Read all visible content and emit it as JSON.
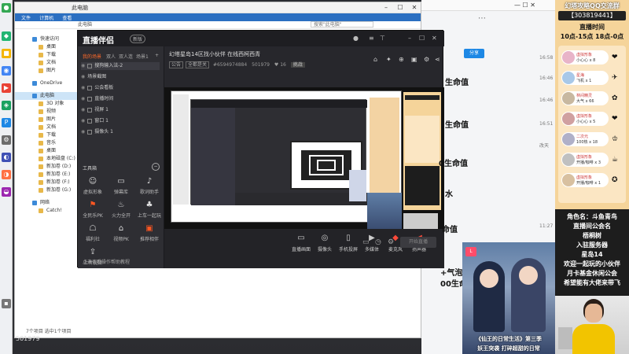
{
  "explorer": {
    "title": "此电脑",
    "ribbon": [
      "文件",
      "计算机",
      "查看"
    ],
    "address": "此电脑",
    "search_placeholder": "搜索\"此电脑\"",
    "sidebar": [
      {
        "label": "快速访问",
        "top": true
      },
      {
        "label": "桌面"
      },
      {
        "label": "下载"
      },
      {
        "label": "文档"
      },
      {
        "label": "图片"
      },
      {
        "label": "OneDrive",
        "top": true
      },
      {
        "label": "此电脑",
        "top": true,
        "selected": true
      },
      {
        "label": "3D 对象"
      },
      {
        "label": "视频"
      },
      {
        "label": "图片"
      },
      {
        "label": "文档"
      },
      {
        "label": "下载"
      },
      {
        "label": "音乐"
      },
      {
        "label": "桌面"
      },
      {
        "label": "本地磁盘 (C:)"
      },
      {
        "label": "新加卷 (D:)"
      },
      {
        "label": "新加卷 (E:)"
      },
      {
        "label": "新加卷 (F:)"
      },
      {
        "label": "新加卷 (G:)"
      },
      {
        "label": "网络",
        "top": true
      },
      {
        "label": "Catch!"
      }
    ],
    "status": "7个项目  选中1个项目"
  },
  "bg": {
    "share_label": "分享",
    "times": [
      "16:58",
      "16:46",
      "16:46",
      "16:51",
      "11:27"
    ],
    "date_label": "改天"
  },
  "app": {
    "logo": "直播伴侣",
    "version": "新版",
    "scene_tabs": [
      "我的场景",
      "双人",
      "双人连",
      "场景1",
      "+"
    ],
    "sources": [
      {
        "label": "搜狗输入法-2",
        "chk": true
      },
      {
        "label": "场景截图"
      },
      {
        "label": "公会看板",
        "chk": true
      },
      {
        "label": "直播时间",
        "chk": true
      },
      {
        "label": "视屏 1",
        "chk": true
      },
      {
        "label": "窗口 1",
        "chk": true
      },
      {
        "label": "摄像头 1",
        "chk": true
      }
    ],
    "tools_title": "工具箱",
    "tools": [
      {
        "label": "虚拟形象",
        "icon": "☺"
      },
      {
        "label": "弹幕库",
        "icon": "▭"
      },
      {
        "label": "歌词助手",
        "icon": "♪"
      },
      {
        "label": "全民乐PK",
        "icon": "⚑",
        "hot": true
      },
      {
        "label": "火力全开",
        "icon": "♨"
      },
      {
        "label": "上车一起玩",
        "icon": "♣"
      },
      {
        "label": "福利社",
        "icon": "☖"
      },
      {
        "label": "视频PK",
        "icon": "⌂"
      },
      {
        "label": "推荐相伴",
        "icon": "▣",
        "hot": true
      },
      {
        "label": "上传视频",
        "icon": "⇪"
      }
    ],
    "footer": "点击查看操作帮助教程",
    "room_title": "幻塔星岛14区找小伙伴  在线西柯西青",
    "room_tags": [
      "公告",
      "全都是关"
    ],
    "room_id": "#6594974884",
    "room_viewers": "501979",
    "room_likes": "16",
    "room_btn": "挑战",
    "bottom": [
      {
        "label": "直播画面",
        "icon": "▭"
      },
      {
        "label": "摄像头",
        "icon": "◎"
      },
      {
        "label": "手机投屏",
        "icon": "▯"
      },
      {
        "label": "多媒体",
        "icon": "▶"
      },
      {
        "label": "麦克风",
        "icon": "◆",
        "red": true
      },
      {
        "label": "扬声器",
        "icon": "◀",
        "red": true
      }
    ],
    "live_btn": "开始直播"
  },
  "overlays": {
    "life1": "生命值",
    "life2": "生命值",
    "life3": "0生命值",
    "life4": "水",
    "life5": "命值",
    "life6": "+气泡水",
    "life7": "00生命值"
  },
  "right_panel": {
    "title": "幻塔攻略QQ交流群",
    "qq": "【303819441】",
    "time_title": "直播时间",
    "time": "10点-15点 18点-0点",
    "gifts": [
      {
        "name": "虚拟形象",
        "count": "小心心 x 8",
        "color": "#e8b4c8",
        "icon": "❤"
      },
      {
        "name": "星海",
        "count": "飞机 x 1",
        "color": "#a8c8e8",
        "icon": "✈"
      },
      {
        "name": "林间精灵",
        "count": "大气 x 66",
        "color": "#c8b8a0",
        "icon": "✿"
      },
      {
        "name": "虚拟形象",
        "count": "小心心 x 5",
        "color": "#d0a0a0",
        "icon": "❤"
      },
      {
        "name": "二次元",
        "count": "100热 x 18",
        "color": "#b0b0c8",
        "icon": "♔"
      },
      {
        "name": "虚拟形象",
        "count": "开播/咖啡 x 3",
        "color": "#c0c0c0",
        "icon": "☕"
      },
      {
        "name": "虚拟形象",
        "count": "开播/咖啡 x 1",
        "color": "#d8c0a0",
        "icon": "✪"
      }
    ],
    "info": [
      "角色名：斗鱼青鸟",
      "直播间公会名",
      "梧桐树",
      "入驻服务器",
      "星岛14",
      "欢迎一起玩的小伙伴",
      "月卡基金休闲公会",
      "希望能有大佬来带飞"
    ]
  },
  "poster": {
    "caption1": "《仙王的日常生活》第三季",
    "caption2": "妖王突袭 打碎超甜的日常"
  },
  "viewer_id": "501979",
  "colors": {
    "accent": "#ff6a2a",
    "panel_bg": "#f5d49a",
    "share_blue": "#1e88e5"
  }
}
